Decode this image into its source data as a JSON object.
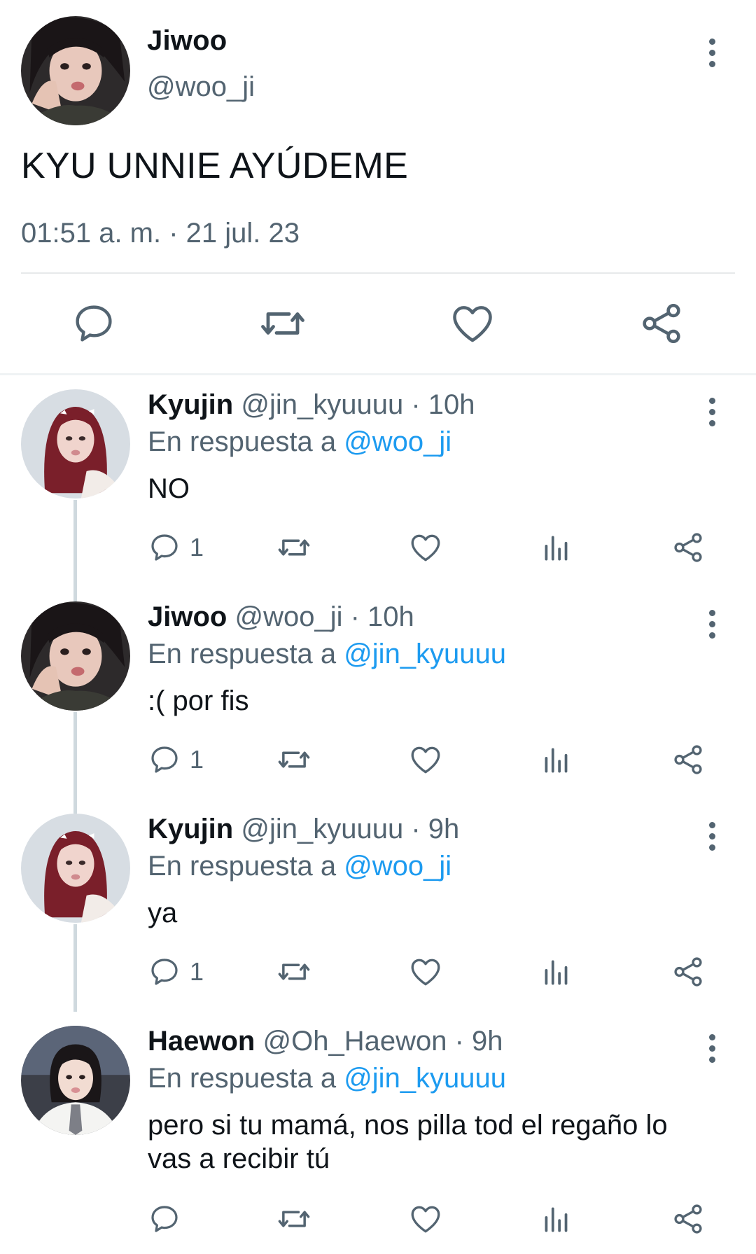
{
  "main_tweet": {
    "name": "Jiwoo",
    "handle": "@woo_ji",
    "text": "KYU UNNIE AYÚDEME",
    "timestamp": "01:51 a. m. · 21 jul. 23",
    "actions": [
      "reply-icon",
      "retweet-icon",
      "like-icon",
      "share-icon"
    ]
  },
  "replies": [
    {
      "name": "Kyujin",
      "handle": "@jin_kyuuuu",
      "time": "· 10h",
      "reply_prefix": "En respuesta a",
      "reply_to": "@woo_ji",
      "text": "NO",
      "reply_count": "1"
    },
    {
      "name": "Jiwoo",
      "handle": "@woo_ji",
      "time": "· 10h",
      "reply_prefix": "En respuesta a",
      "reply_to": "@jin_kyuuuu",
      "text": ":( por fis",
      "reply_count": "1"
    },
    {
      "name": "Kyujin",
      "handle": "@jin_kyuuuu",
      "time": "· 9h",
      "reply_prefix": "En respuesta a",
      "reply_to": "@woo_ji",
      "text": "ya",
      "reply_count": "1"
    },
    {
      "name": "Haewon",
      "handle": "@Oh_Haewon",
      "time": "· 9h",
      "reply_prefix": "En respuesta a",
      "reply_to": "@jin_kyuuuu",
      "text": "pero si tu mamá, nos pilla tod el regaño lo vas a recibir tú",
      "reply_count": ""
    }
  ],
  "colors": {
    "text": "#0f1419",
    "secondary": "#536471",
    "link": "#1d9bf0",
    "divider": "#e7e9ea",
    "thread_line": "#cfd9de"
  }
}
